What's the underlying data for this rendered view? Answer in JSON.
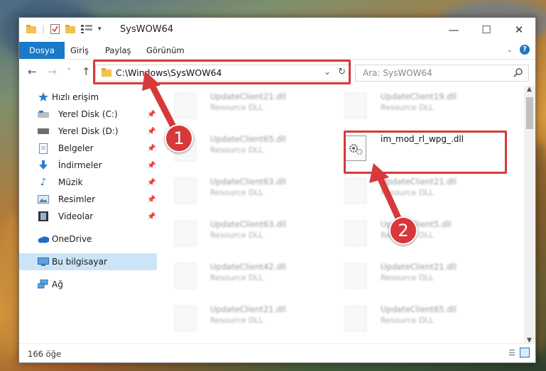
{
  "window": {
    "title": "SysWOW64"
  },
  "ribbon": {
    "tabs": [
      "Dosya",
      "Giriş",
      "Paylaş",
      "Görünüm"
    ],
    "help": "?"
  },
  "nav": {
    "address": "C:\\Windows\\SysWOW64",
    "search_placeholder": "Ara: SysWOW64"
  },
  "sidebar": {
    "items": [
      {
        "label": "Hızlı erişim",
        "icon": "star-icon"
      },
      {
        "label": "Yerel Disk (C:)",
        "icon": "drive-icon"
      },
      {
        "label": "Yerel Disk (D:)",
        "icon": "drive-icon"
      },
      {
        "label": "Belgeler",
        "icon": "documents-icon"
      },
      {
        "label": "İndirmeler",
        "icon": "download-icon"
      },
      {
        "label": "Müzik",
        "icon": "music-icon"
      },
      {
        "label": "Resimler",
        "icon": "pictures-icon"
      },
      {
        "label": "Videolar",
        "icon": "videos-icon"
      },
      {
        "label": "OneDrive",
        "icon": "cloud-icon"
      },
      {
        "label": "Bu bilgisayar",
        "icon": "computer-icon"
      },
      {
        "label": "Ağ",
        "icon": "network-icon"
      }
    ]
  },
  "files": {
    "left": [
      {
        "name": "UpdateClient21.dll",
        "type": "Resource DLL"
      },
      {
        "name": "UpdateClient65.dll",
        "type": "Resource DLL"
      },
      {
        "name": "UpdateClient63.dll",
        "type": "Resource DLL"
      },
      {
        "name": "UpdateClient63.dll",
        "type": "Resource DLL"
      },
      {
        "name": "UpdateClient42.dll",
        "type": "Resource DLL"
      },
      {
        "name": "UpdateClient21.dll",
        "type": "Resource DLL"
      }
    ],
    "right": [
      {
        "name": "UpdateClient19.dll",
        "type": "Resource DLL"
      },
      {
        "name": "im_mod_rl_wpg_.dll",
        "type": ""
      },
      {
        "name": "UpdateClient21.dll",
        "type": "Resource DLL"
      },
      {
        "name": "UpdateClient5.dll",
        "type": "Resource DLL"
      },
      {
        "name": "UpdateClient21.dll",
        "type": "Resource DLL"
      },
      {
        "name": "UpdateClient65.dll",
        "type": "Resource DLL"
      }
    ]
  },
  "status": {
    "count": "166 öğe"
  },
  "annotations": {
    "step1": "1",
    "step2": "2"
  },
  "colors": {
    "accent": "#1979ca",
    "highlight": "#d7393a",
    "selected": "#cce4f7"
  }
}
